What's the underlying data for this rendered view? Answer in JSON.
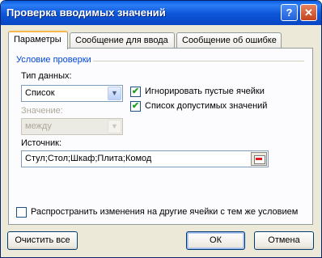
{
  "window": {
    "title": "Проверка вводимых значений"
  },
  "titlebar": {
    "help_label": "?",
    "close_label": "✕"
  },
  "tabs": [
    {
      "label": "Параметры"
    },
    {
      "label": "Сообщение для ввода"
    },
    {
      "label": "Сообщение об ошибке"
    }
  ],
  "group": {
    "label": "Условие проверки"
  },
  "data_type": {
    "label": "Тип данных:",
    "value": "Список"
  },
  "checkboxes": [
    {
      "label": "Игнорировать пустые ячейки",
      "checked": true
    },
    {
      "label": "Список допустимых значений",
      "checked": true
    }
  ],
  "value_field": {
    "label": "Значение:",
    "value": "между"
  },
  "source": {
    "label": "Источник:",
    "value": "Стул;Стол;Шкаф;Плита;Комод"
  },
  "apply_all": {
    "label": "Распространить изменения на другие ячейки с тем же условием",
    "checked": false
  },
  "buttons": {
    "clear_all": "Очистить все",
    "ok": "ОК",
    "cancel": "Отмена"
  },
  "colors": {
    "titlebar": "#0a5fe0",
    "group_label": "#0046d5",
    "dialog_bg": "#ece9d8",
    "tab_active_top": "#f7b64a"
  }
}
